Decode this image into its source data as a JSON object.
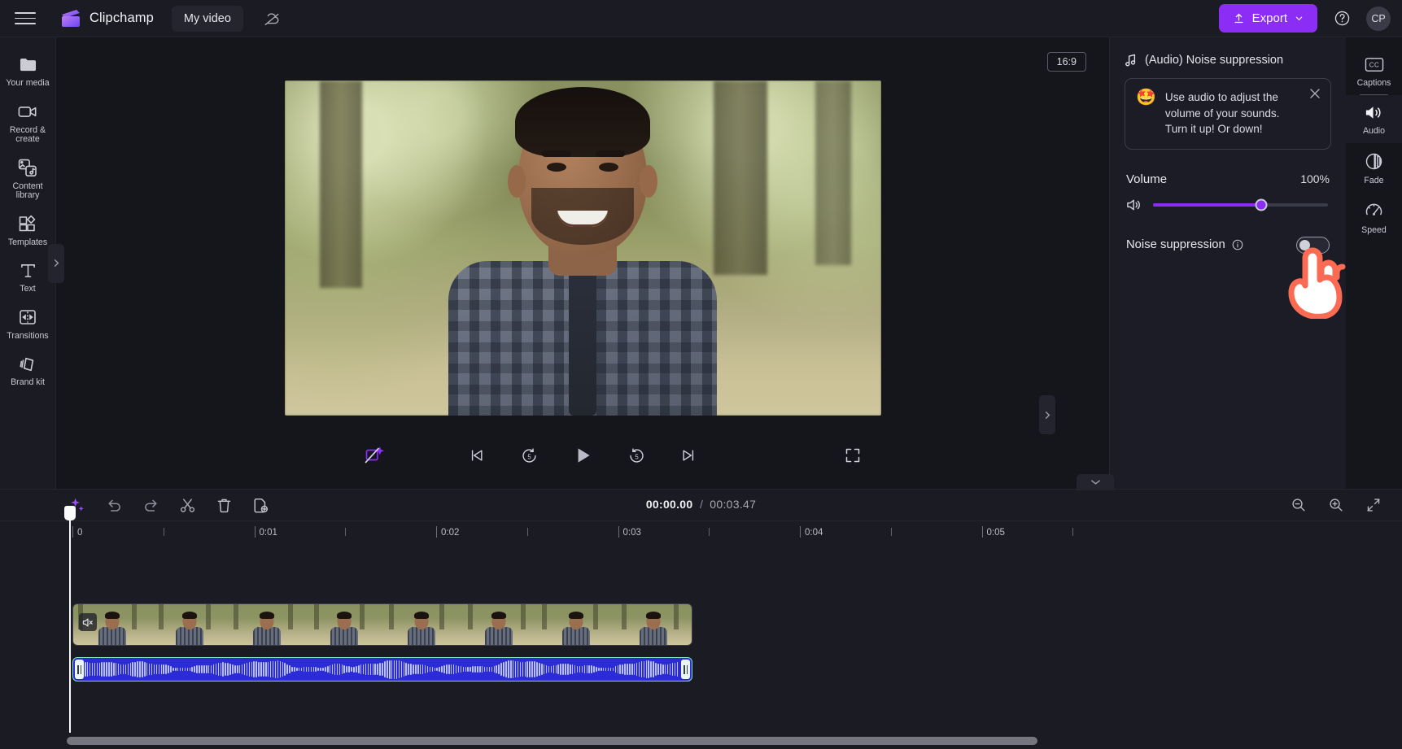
{
  "app": {
    "brand_name": "Clipchamp",
    "project_name": "My video",
    "menu_icon": "hamburger-icon",
    "cloud_icon": "cloud-off-icon"
  },
  "topbar": {
    "export_label": "Export",
    "export_icon": "upload-icon",
    "export_caret": "chevron-down-icon",
    "help_icon": "help-circle-icon",
    "avatar_initials": "CP",
    "export_color": "#8b2df5"
  },
  "sidebar": {
    "items": [
      {
        "label": "Your media",
        "icon": "folder-icon"
      },
      {
        "label": "Record & create",
        "icon": "video-camera-icon"
      },
      {
        "label": "Content library",
        "icon": "content-library-icon"
      },
      {
        "label": "Templates",
        "icon": "templates-icon"
      },
      {
        "label": "Text",
        "icon": "text-icon"
      },
      {
        "label": "Transitions",
        "icon": "transitions-icon"
      },
      {
        "label": "Brand kit",
        "icon": "brand-kit-icon"
      }
    ],
    "collapse_icon": "chevron-right-icon"
  },
  "stage": {
    "aspect_ratio": "16:9",
    "collapse_right_icon": "chevron-right-icon",
    "collapse_down_icon": "chevron-down-icon"
  },
  "transport": {
    "autofix_icon": "magic-fix-icon",
    "prev_icon": "skip-previous-icon",
    "back5_icon": "rewind-5-icon",
    "play_icon": "play-icon",
    "fwd5_icon": "forward-5-icon",
    "next_icon": "skip-next-icon",
    "fullscreen_icon": "fullscreen-icon"
  },
  "properties": {
    "header_title": "(Audio) Noise suppression",
    "header_icon": "music-note-icon",
    "tip": {
      "emoji": "🤩",
      "text": "Use audio to adjust the volume of your sounds. Turn it up! Or down!",
      "close_icon": "close-icon"
    },
    "volume": {
      "label": "Volume",
      "value": "100%",
      "percent": 62,
      "icon": "speaker-icon",
      "accent": "#8b2df5"
    },
    "noise_suppression": {
      "label": "Noise suppression",
      "info_icon": "info-circle-icon",
      "enabled": false
    }
  },
  "right_rail": {
    "items": [
      {
        "label": "Captions",
        "icon": "closed-captions-icon",
        "active": false
      },
      {
        "label": "Audio",
        "icon": "speaker-icon",
        "active": true
      },
      {
        "label": "Fade",
        "icon": "fade-icon",
        "active": false
      },
      {
        "label": "Speed",
        "icon": "speedometer-icon",
        "active": false
      }
    ]
  },
  "timeline": {
    "tools": [
      {
        "name": "ai-magic-tool",
        "icon": "sparkle-icon"
      },
      {
        "name": "undo-tool",
        "icon": "undo-icon"
      },
      {
        "name": "redo-tool",
        "icon": "redo-icon"
      },
      {
        "name": "split-tool",
        "icon": "scissors-icon"
      },
      {
        "name": "delete-tool",
        "icon": "trash-icon"
      },
      {
        "name": "duplicate-tool",
        "icon": "duplicate-icon"
      }
    ],
    "current_time": "00:00.00",
    "separator": "/",
    "total_time": "00:03.47",
    "zoom_controls": [
      {
        "name": "zoom-out-button",
        "icon": "magnifier-minus-icon"
      },
      {
        "name": "zoom-in-button",
        "icon": "magnifier-plus-icon"
      },
      {
        "name": "fit-to-screen-button",
        "icon": "fit-screen-icon"
      }
    ],
    "ruler_labels": [
      "0",
      "0:01",
      "0:02",
      "0:03",
      "0:04",
      "0:05"
    ],
    "video_clip": {
      "name": "video-clip",
      "mute_icon": "speaker-muted-icon"
    },
    "audio_clip": {
      "name": "audio-clip"
    }
  },
  "cursor": {
    "type": "pointing-hand-cursor"
  }
}
